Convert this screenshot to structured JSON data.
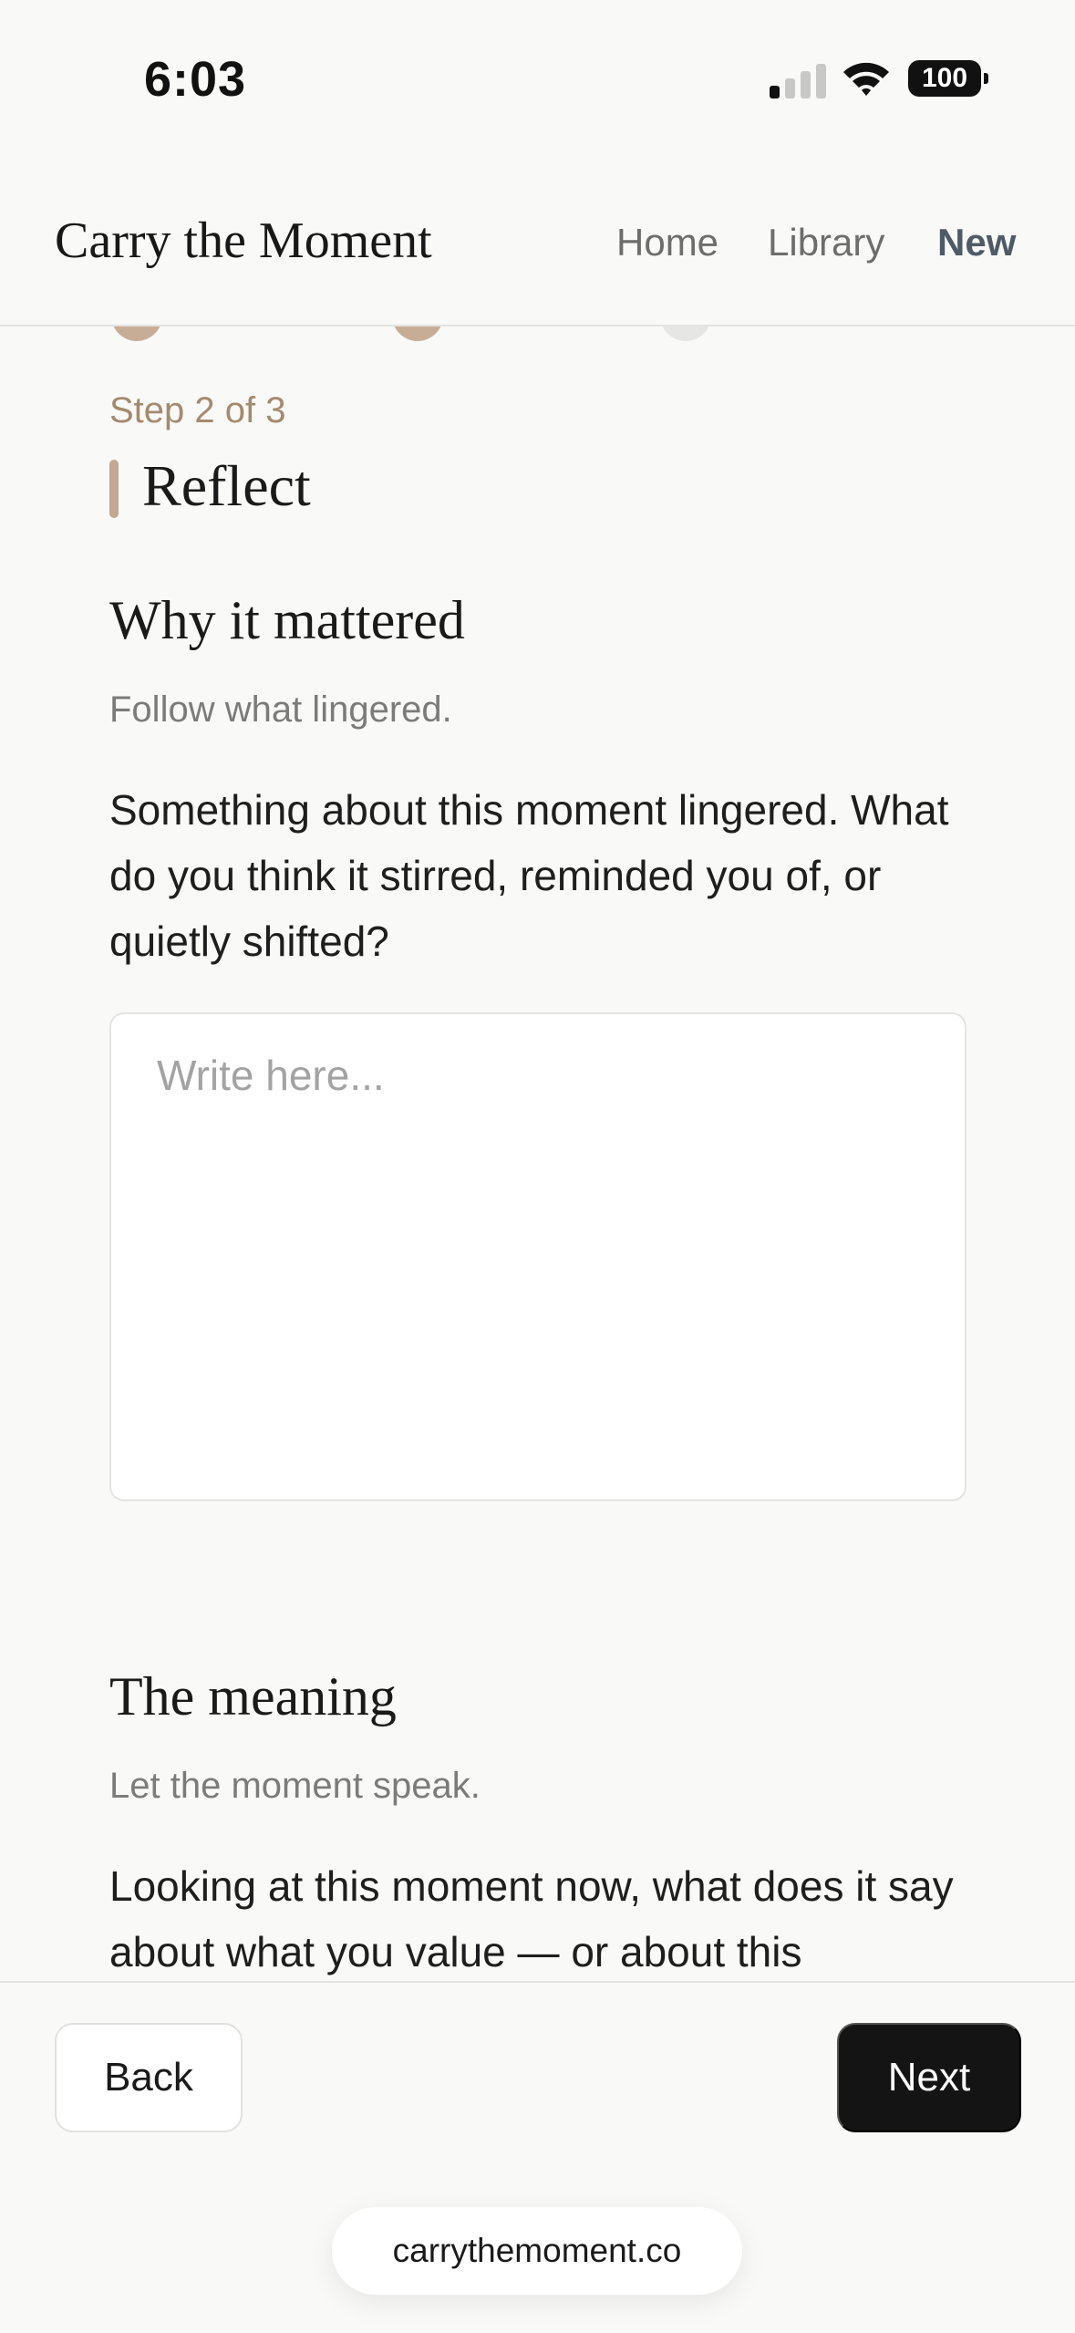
{
  "status_bar": {
    "time": "6:03",
    "battery": "100"
  },
  "header": {
    "brand": "Carry the Moment",
    "nav": [
      {
        "label": "Home",
        "active": false
      },
      {
        "label": "Library",
        "active": false
      },
      {
        "label": "New",
        "active": true
      }
    ]
  },
  "step": {
    "label": "Step 2 of 3",
    "title": "Reflect"
  },
  "sections": [
    {
      "title": "Why it mattered",
      "subtitle": "Follow what lingered.",
      "prompt": "Something about this moment lingered. What do you think it stirred, reminded you of, or quietly shifted?",
      "placeholder": "Write here..."
    },
    {
      "title": "The meaning",
      "subtitle": "Let the moment speak.",
      "prompt": "Looking at this moment now, what does it say about what you value — or about this"
    }
  ],
  "footer": {
    "back_label": "Back",
    "next_label": "Next"
  },
  "browser": {
    "url": "carrythemoment.co"
  },
  "colors": {
    "accent": "#c2a892",
    "step_label": "#a48a6e",
    "primary_button": "#141414",
    "nav_active": "#4e5b66"
  }
}
